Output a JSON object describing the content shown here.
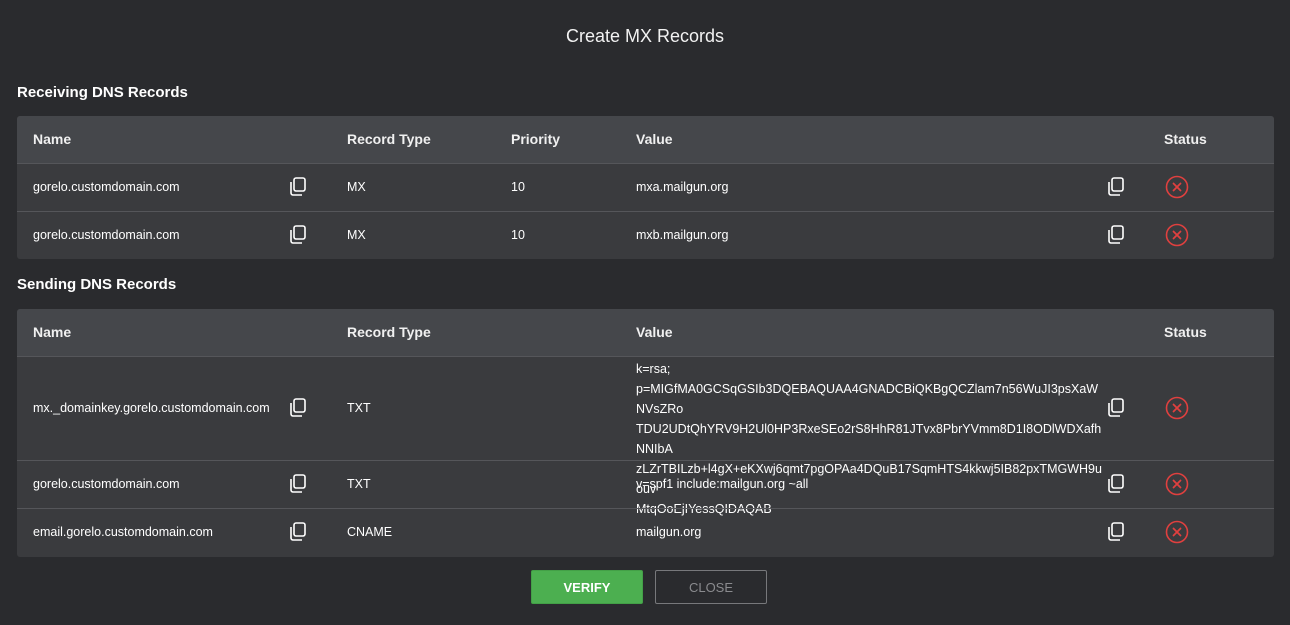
{
  "dialog": {
    "title": "Create MX Records"
  },
  "receiving": {
    "heading": "Receiving DNS Records",
    "columns": {
      "name": "Name",
      "type": "Record Type",
      "priority": "Priority",
      "value": "Value",
      "status": "Status"
    },
    "rows": [
      {
        "name": "gorelo.customdomain.com",
        "type": "MX",
        "priority": "10",
        "value": "mxa.mailgun.org"
      },
      {
        "name": "gorelo.customdomain.com",
        "type": "MX",
        "priority": "10",
        "value": "mxb.mailgun.org"
      }
    ]
  },
  "sending": {
    "heading": "Sending DNS Records",
    "columns": {
      "name": "Name",
      "type": "Record Type",
      "value": "Value",
      "status": "Status"
    },
    "rows": [
      {
        "name": "mx._domainkey.gorelo.customdomain.com",
        "type": "TXT",
        "value_lines": [
          "k=rsa;",
          "p=MIGfMA0GCSqGSIb3DQEBAQUAA4GNADCBiQKBgQCZlam7n56WuJI3psXaWNVsZRo",
          "TDU2UDtQhYRV9H2Ul0HP3RxeSEo2rS8HhR81JTvx8PbrYVmm8D1I8ODlWDXafhNNIbA",
          "zLZrTBILzb+l4gX+eKXwj6qmt7pgOPAa4DQuB17SqmHTS4kkwj5IB82pxTMGWH9uouv",
          "MtqOoEjIYessQIDAQAB"
        ]
      },
      {
        "name": "gorelo.customdomain.com",
        "type": "TXT",
        "value": "v=spf1 include:mailgun.org ~all"
      },
      {
        "name": "email.gorelo.customdomain.com",
        "type": "CNAME",
        "value": "mailgun.org"
      }
    ]
  },
  "actions": {
    "verify_label": "VERIFY",
    "close_label": "CLOSE"
  },
  "icons": {
    "copy": "copy-icon",
    "status": "error-circle-x-icon"
  },
  "colors": {
    "background": "#2a2b2e",
    "table": "#3a3b3e",
    "header": "#45474b",
    "error": "#e0403f",
    "verify": "#4caf50"
  }
}
